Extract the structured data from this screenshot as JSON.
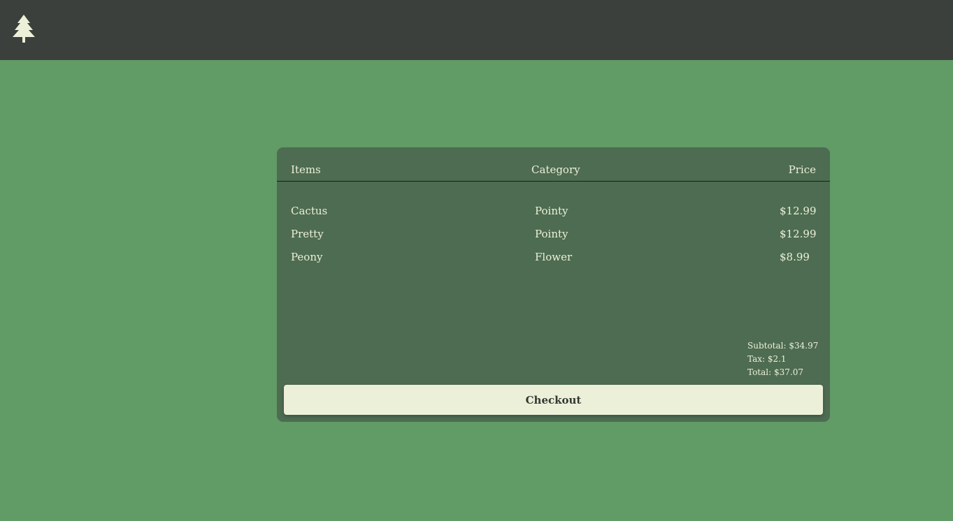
{
  "header": {
    "logo_icon": "pine-tree-icon"
  },
  "cart": {
    "columns": {
      "items": "Items",
      "category": "Category",
      "price": "Price"
    },
    "rows": [
      {
        "item": "Cactus",
        "category": "Pointy",
        "price": "$12.99"
      },
      {
        "item": "Pretty",
        "category": "Pointy",
        "price": "$12.99"
      },
      {
        "item": "Peony",
        "category": "Flower",
        "price": "$8.99"
      }
    ],
    "subtotal": "Subtotal: $34.97",
    "tax": "Tax: $2.1",
    "total": "Total: $37.07",
    "checkout_label": "Checkout"
  },
  "colors": {
    "page_bg": "#619b66",
    "topbar_bg": "#3b403d",
    "card_bg": "#4d6c51",
    "text_light": "#edf0d9"
  }
}
